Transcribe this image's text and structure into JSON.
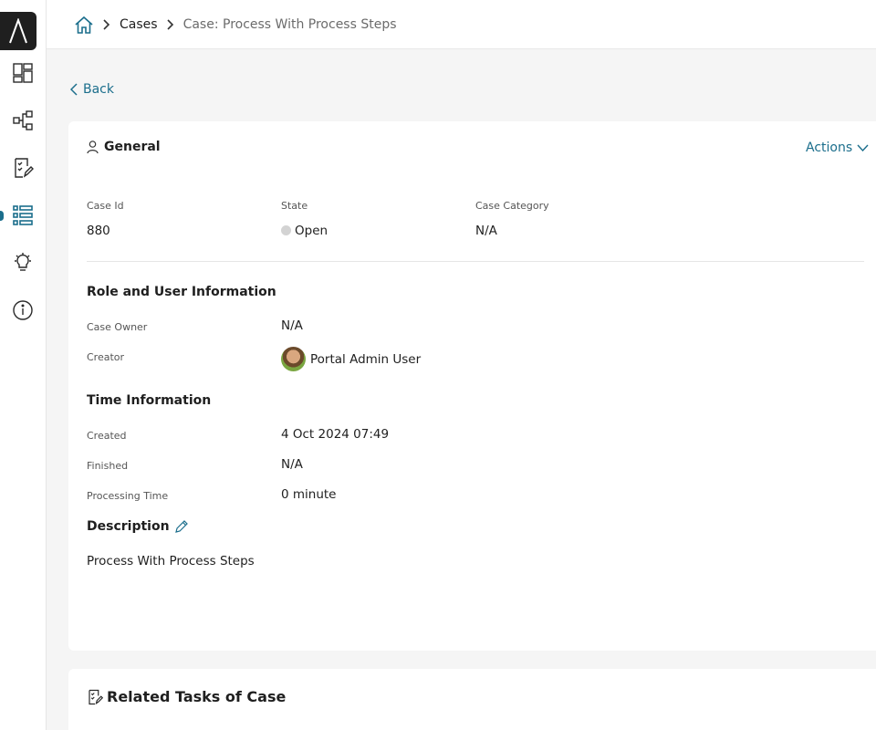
{
  "colors": {
    "accent": "#1b6e8c",
    "logo_bg": "#1f1f1f",
    "state_open": "#d3d3d3"
  },
  "sidebar": {
    "items": [
      {
        "name": "dashboard-icon"
      },
      {
        "name": "process-icon"
      },
      {
        "name": "tasks-icon"
      },
      {
        "name": "cases-icon",
        "active": true
      },
      {
        "name": "statistics-icon"
      },
      {
        "name": "info-icon"
      }
    ]
  },
  "breadcrumb": {
    "home_icon": "home-icon",
    "cases": "Cases",
    "current": "Case: Process With Process Steps"
  },
  "back_label": "Back",
  "general": {
    "title": "General",
    "actions_label": "Actions",
    "case_id_label": "Case Id",
    "case_id_value": "880",
    "state_label": "State",
    "state_value": "Open",
    "case_category_label": "Case Category",
    "case_category_value": "N/A"
  },
  "role_info": {
    "title": "Role and User Information",
    "case_owner_label": "Case Owner",
    "case_owner_value": "N/A",
    "creator_label": "Creator",
    "creator_value": "Portal Admin User"
  },
  "time_info": {
    "title": "Time Information",
    "created_label": "Created",
    "created_value": "4 Oct 2024 07:49",
    "finished_label": "Finished",
    "finished_value": "N/A",
    "processing_time_label": "Processing Time",
    "processing_time_value": "0 minute"
  },
  "description": {
    "title": "Description",
    "value": "Process With Process Steps"
  },
  "related_tasks": {
    "title": "Related Tasks of Case"
  }
}
